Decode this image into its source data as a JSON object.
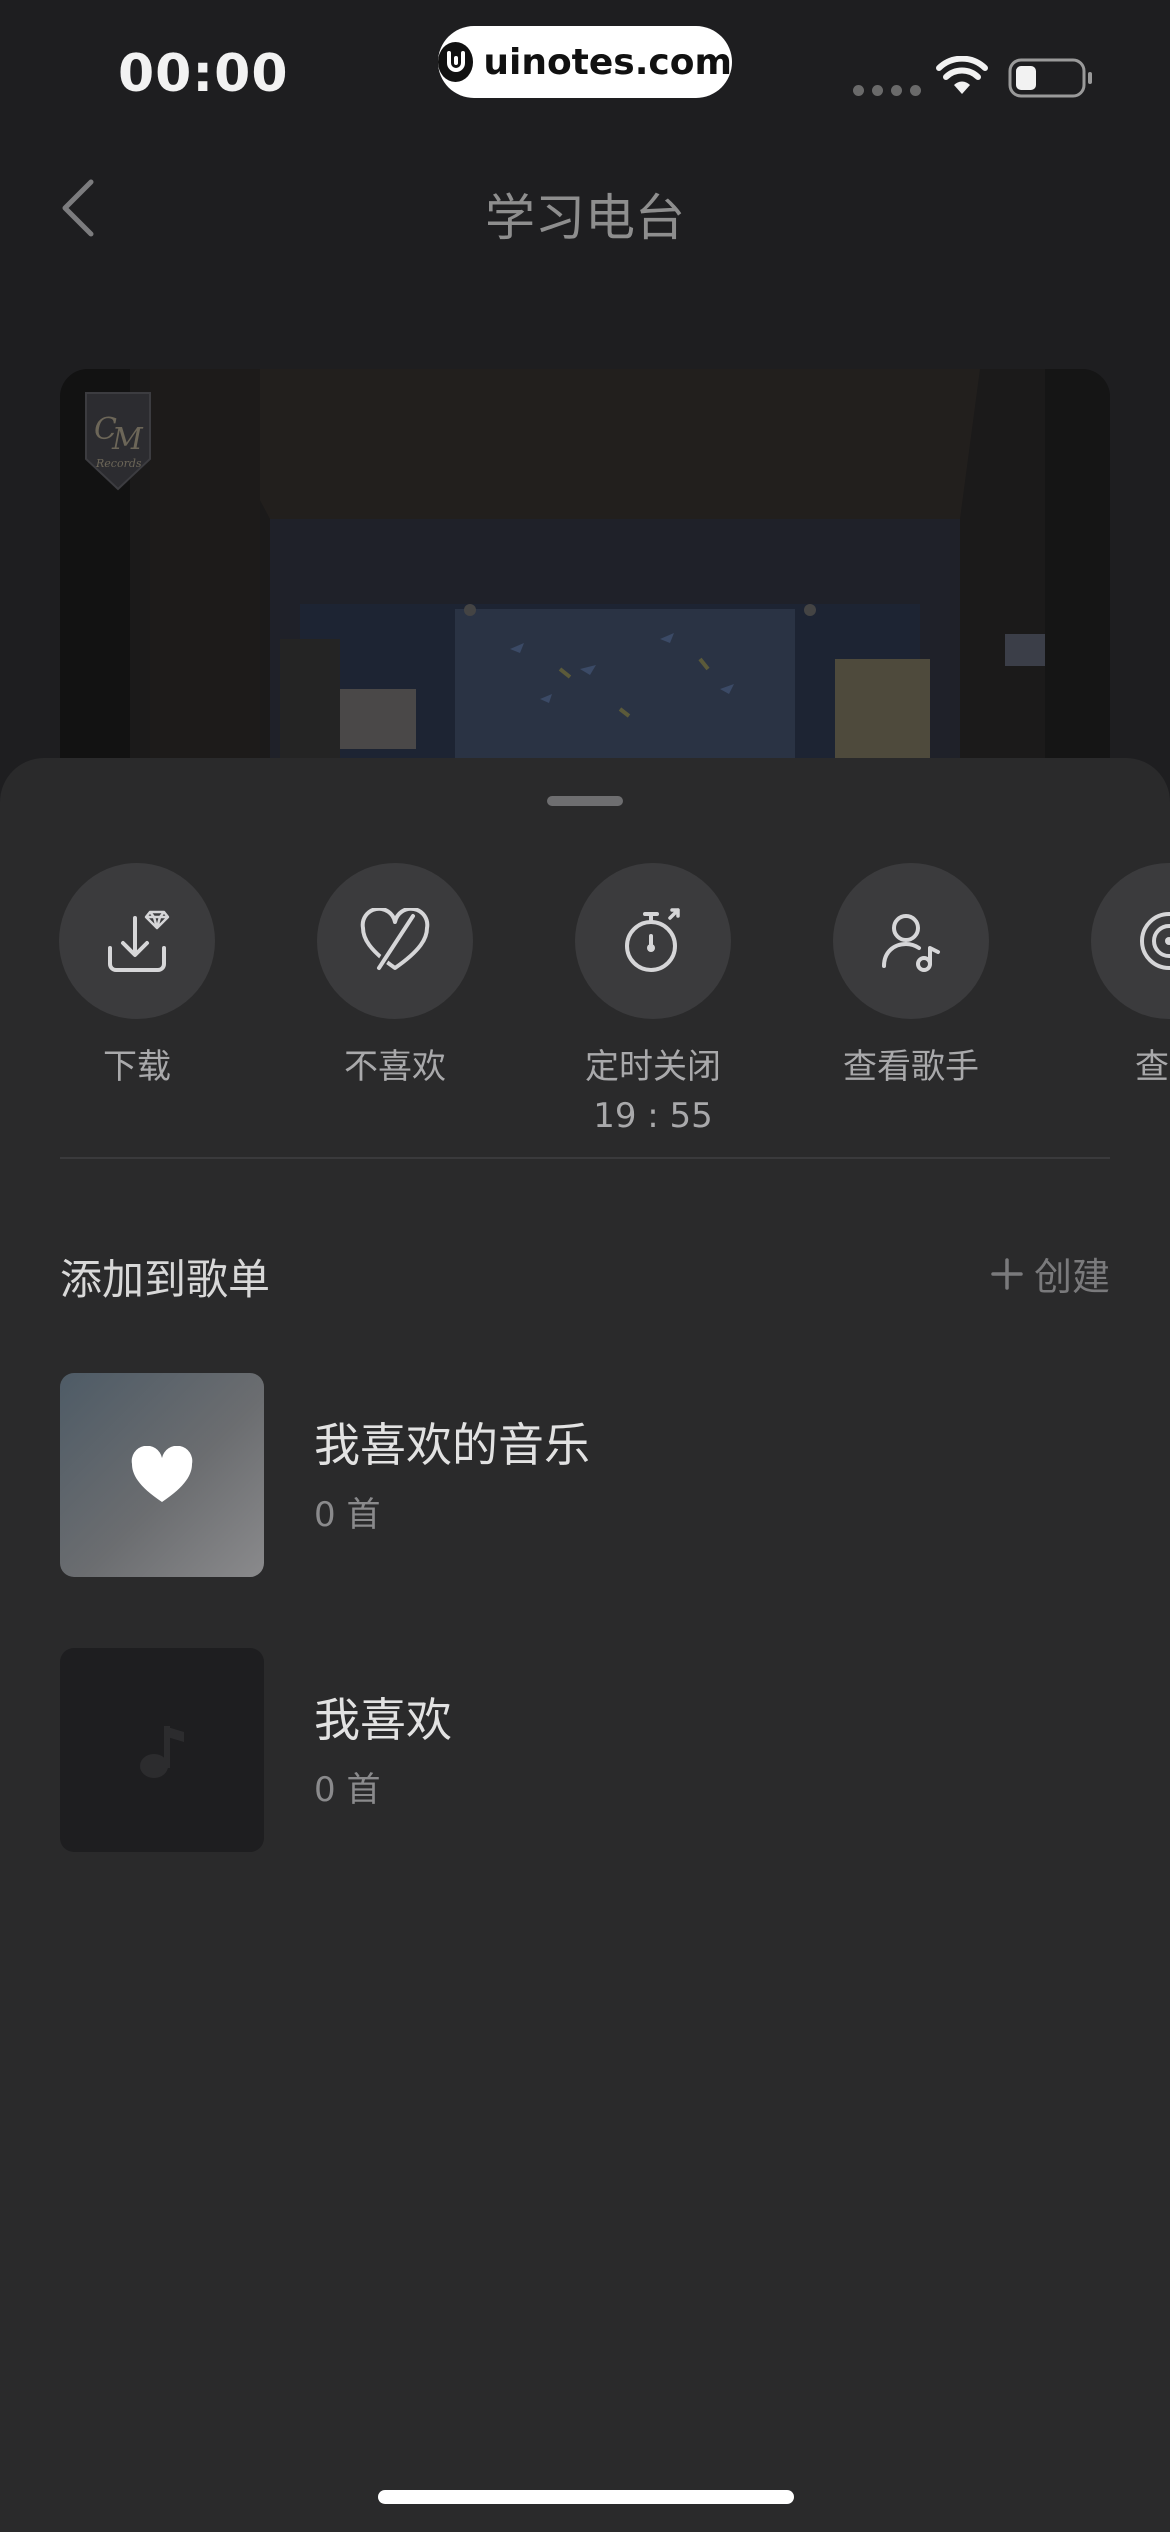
{
  "status_bar": {
    "time": "00:00",
    "watermark": "uinotes.com",
    "wifi_icon": "wifi-icon",
    "battery_icon": "battery-icon",
    "battery_level": 0.3
  },
  "nav": {
    "back_icon": "chevron-left-icon",
    "title": "学习电台"
  },
  "cover": {
    "logo_text": "CM",
    "logo_sub": "Records"
  },
  "actions": [
    {
      "label": "下载",
      "sublabel": "",
      "icon": "download-icon"
    },
    {
      "label": "不喜欢",
      "sublabel": "",
      "icon": "dislike-heart-icon"
    },
    {
      "label": "定时关闭",
      "sublabel": "19 : 55",
      "icon": "timer-icon"
    },
    {
      "label": "查看歌手",
      "sublabel": "",
      "icon": "artist-icon"
    },
    {
      "label": "查看",
      "sublabel": "",
      "icon": "album-icon"
    }
  ],
  "playlists_section": {
    "title": "添加到歌单",
    "create_label": "创建",
    "items": [
      {
        "name": "我喜欢的音乐",
        "count": "0 首",
        "icon": "heart-icon"
      },
      {
        "name": "我喜欢",
        "count": "0 首",
        "icon": "music-note-icon"
      }
    ]
  },
  "colors": {
    "sheet_bg": "#2a2a2b",
    "action_circle": "#3b3b3d",
    "primary_text": "#e2e2e2",
    "secondary_text": "#8a8a8c"
  }
}
